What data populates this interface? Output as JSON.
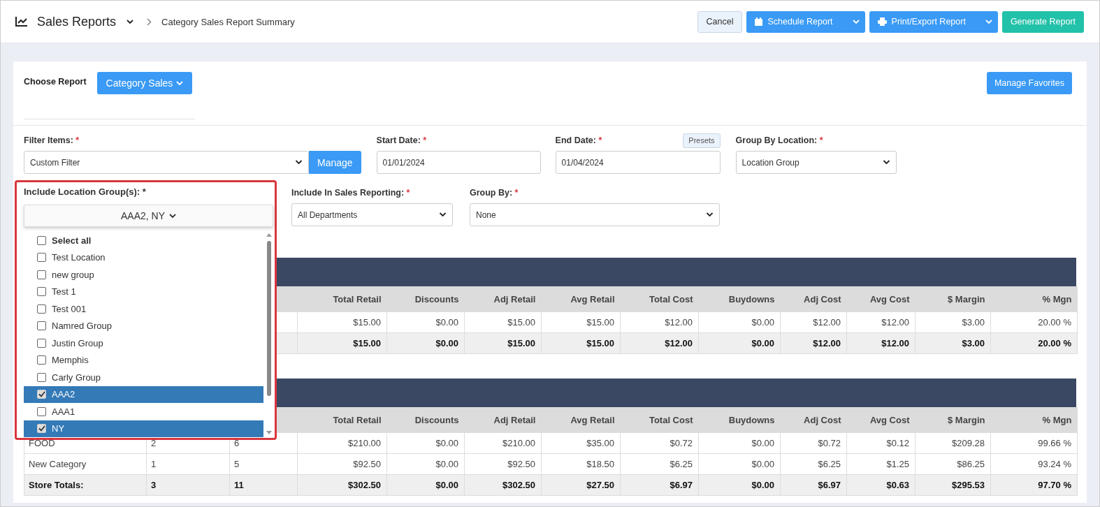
{
  "header": {
    "title": "Sales Reports",
    "breadcrumb": "Category Sales Report Summary",
    "cancel": "Cancel",
    "schedule": "Schedule Report",
    "print_export": "Print/Export Report",
    "generate": "Generate Report"
  },
  "choose_report": {
    "label": "Choose Report",
    "value": "Category Sales"
  },
  "manage_favorites": "Manage Favorites",
  "filters": {
    "required_mark": "*",
    "filter_items": {
      "label": "Filter Items:",
      "value": "Custom Filter",
      "button": "Manage"
    },
    "start_date": {
      "label": "Start Date:",
      "value": "01/01/2024"
    },
    "end_date": {
      "label": "End Date:",
      "value": "01/04/2024",
      "presets": "Presets"
    },
    "group_by_location": {
      "label": "Group By Location:",
      "value": "Location Group"
    },
    "include_in_sales": {
      "label": "Include In Sales Reporting:",
      "value": "All Departments"
    },
    "group_by": {
      "label": "Group By:",
      "value": "None"
    }
  },
  "location_groups": {
    "label": "Include Location Group(s): *",
    "value": "AAA2, NY",
    "options": [
      {
        "label": "Select all",
        "kind": "select_all",
        "checked": false
      },
      {
        "label": "Test Location",
        "kind": "option",
        "checked": false
      },
      {
        "label": "new group",
        "kind": "option",
        "checked": false
      },
      {
        "label": "Test 1",
        "kind": "option",
        "checked": false
      },
      {
        "label": "Test 001",
        "kind": "option",
        "checked": false
      },
      {
        "label": "Namred Group",
        "kind": "option",
        "checked": false
      },
      {
        "label": "Justin Group",
        "kind": "option",
        "checked": false
      },
      {
        "label": "Memphis",
        "kind": "option",
        "checked": false
      },
      {
        "label": "Carly Group",
        "kind": "option",
        "checked": false
      },
      {
        "label": "AAA2",
        "kind": "option",
        "checked": true
      },
      {
        "label": "AAA1",
        "kind": "option",
        "checked": false
      },
      {
        "label": "NY",
        "kind": "option",
        "checked": true
      }
    ]
  },
  "tables": [
    {
      "columns": [
        "",
        "",
        "",
        "Total Retail",
        "Discounts",
        "Adj Retail",
        "Avg Retail",
        "Total Cost",
        "Buydowns",
        "Adj Cost",
        "Avg Cost",
        "$ Margin",
        "% Mgn"
      ],
      "rows": [
        {
          "kind": "data",
          "cells": [
            "",
            "",
            "",
            "$15.00",
            "$0.00",
            "$15.00",
            "$15.00",
            "$12.00",
            "$0.00",
            "$12.00",
            "$12.00",
            "$3.00",
            "20.00 %"
          ]
        },
        {
          "kind": "total",
          "cells": [
            "",
            "",
            "",
            "$15.00",
            "$0.00",
            "$15.00",
            "$15.00",
            "$12.00",
            "$0.00",
            "$12.00",
            "$12.00",
            "$3.00",
            "20.00 %"
          ]
        }
      ]
    },
    {
      "columns": [
        "",
        "",
        "",
        "Total Retail",
        "Discounts",
        "Adj Retail",
        "Avg Retail",
        "Total Cost",
        "Buydowns",
        "Adj Cost",
        "Avg Cost",
        "$ Margin",
        "% Mgn"
      ],
      "rows": [
        {
          "kind": "data",
          "cells": [
            "FOOD",
            "2",
            "6",
            "$210.00",
            "$0.00",
            "$210.00",
            "$35.00",
            "$0.72",
            "$0.00",
            "$0.72",
            "$0.12",
            "$209.28",
            "99.66 %"
          ]
        },
        {
          "kind": "data",
          "cells": [
            "New Category",
            "1",
            "5",
            "$92.50",
            "$0.00",
            "$92.50",
            "$18.50",
            "$6.25",
            "$0.00",
            "$6.25",
            "$1.25",
            "$86.25",
            "93.24 %"
          ]
        },
        {
          "kind": "total",
          "cells": [
            "Store Totals:",
            "3",
            "11",
            "$302.50",
            "$0.00",
            "$302.50",
            "$27.50",
            "$6.97",
            "$0.00",
            "$6.97",
            "$0.63",
            "$295.53",
            "97.70 %"
          ]
        }
      ]
    }
  ]
}
